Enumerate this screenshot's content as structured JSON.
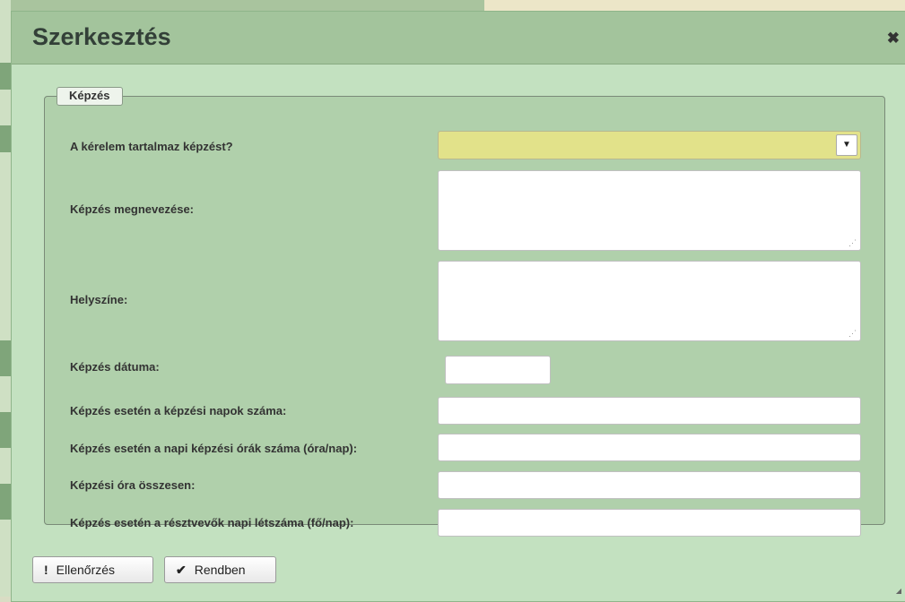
{
  "dialog": {
    "title": "Szerkesztés",
    "close_icon": "close-icon"
  },
  "fieldset": {
    "legend": "Képzés"
  },
  "fields": {
    "contains_training": {
      "label": "A kérelem tartalmaz képzést?",
      "value": ""
    },
    "training_name": {
      "label": "Képzés megnevezése:",
      "value": ""
    },
    "location": {
      "label": "Helyszíne:",
      "value": ""
    },
    "training_date": {
      "label": "Képzés dátuma:",
      "value": ""
    },
    "training_days": {
      "label": "Képzés esetén a képzési napok száma:",
      "value": ""
    },
    "daily_hours": {
      "label": "Képzés esetén a napi képzési órák száma (óra/nap):",
      "value": ""
    },
    "total_hours": {
      "label": "Képzési óra összesen:",
      "value": ""
    },
    "participants": {
      "label": "Képzés esetén a résztvevők napi létszáma (fő/nap):",
      "value": ""
    }
  },
  "buttons": {
    "check": {
      "label": "Ellenőrzés",
      "icon": "exclamation-icon"
    },
    "ok": {
      "label": "Rendben",
      "icon": "checkmark-icon"
    }
  },
  "colors": {
    "dialog_bg": "#c3e1c0",
    "titlebar_bg": "#a3c49c",
    "fieldset_bg": "#b0d0ab",
    "select_highlight": "#e2e28a"
  }
}
